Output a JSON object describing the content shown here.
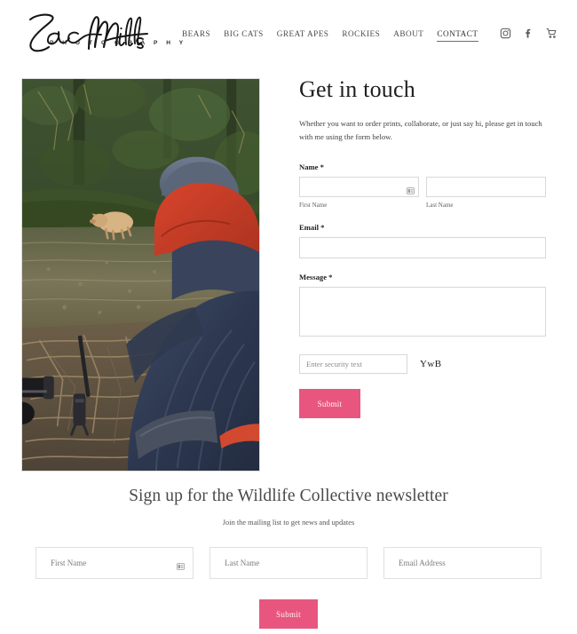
{
  "header": {
    "logo": {
      "name": "Zac Mills",
      "subtitle": "P H O T O G R A P H Y"
    },
    "nav": [
      {
        "label": "BEARS",
        "active": false
      },
      {
        "label": "BIG CATS",
        "active": false
      },
      {
        "label": "GREAT APES",
        "active": false
      },
      {
        "label": "ROCKIES",
        "active": false
      },
      {
        "label": "ABOUT",
        "active": false
      },
      {
        "label": "CONTACT",
        "active": true
      }
    ],
    "social": [
      {
        "icon": "instagram-icon"
      },
      {
        "icon": "facebook-icon"
      },
      {
        "icon": "shopping-cart-icon"
      }
    ]
  },
  "photo": {
    "alt": "Photographer in navy and red jacket kneeling by a creek watching a spirit bear in a mossy rainforest"
  },
  "contact": {
    "heading": "Get in touch",
    "description": "Whether you want to order prints, collaborate, or just say hi, please get in touch with me using the form below.",
    "name_label": "Name *",
    "first_name_value": "",
    "first_name_sublabel": "First Name",
    "last_name_value": "",
    "last_name_sublabel": "Last Name",
    "email_label": "Email *",
    "email_value": "",
    "message_label": "Message *",
    "message_value": "",
    "captcha_placeholder": "Enter security text",
    "captcha_value": "",
    "captcha_code": "YwB",
    "submit_label": "Submit"
  },
  "newsletter": {
    "heading": "Sign up for the Wildlife Collective newsletter",
    "subheading": "Join the mailing list to get news and updates",
    "first_name_placeholder": "First Name",
    "last_name_placeholder": "Last Name",
    "email_placeholder": "Email Address",
    "submit_label": "Submit"
  },
  "colors": {
    "accent_pink": "#e8567f",
    "text_dark": "#1f1f1f",
    "text_muted": "#5e5e5e",
    "border": "#d8d8d8",
    "background": "#ffffff"
  }
}
